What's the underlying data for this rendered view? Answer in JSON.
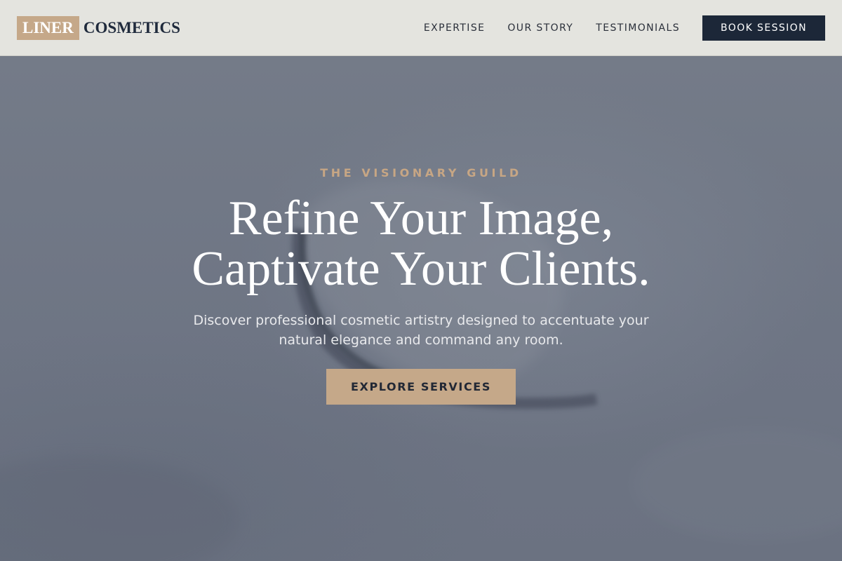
{
  "brand": {
    "mark": "LINER",
    "word": "COSMETICS"
  },
  "nav": {
    "items": [
      {
        "label": "EXPERTISE"
      },
      {
        "label": "OUR STORY"
      },
      {
        "label": "TESTIMONIALS"
      }
    ],
    "cta_label": "BOOK SESSION"
  },
  "hero": {
    "eyebrow": "THE VISIONARY GUILD",
    "headline_line1": "Refine Your Image,",
    "headline_line2": "Captivate Your Clients.",
    "subtext_line1": "Discover professional cosmetic artistry designed to accentuate your",
    "subtext_line2": "natural elegance and command any room.",
    "cta_label": "EXPLORE SERVICES"
  },
  "colors": {
    "navbar_bg": "#e4e4df",
    "accent_tan": "#c5a889",
    "navy": "#1c2738",
    "hero_overlay": "#6f7683",
    "eyebrow": "#c7a684"
  }
}
